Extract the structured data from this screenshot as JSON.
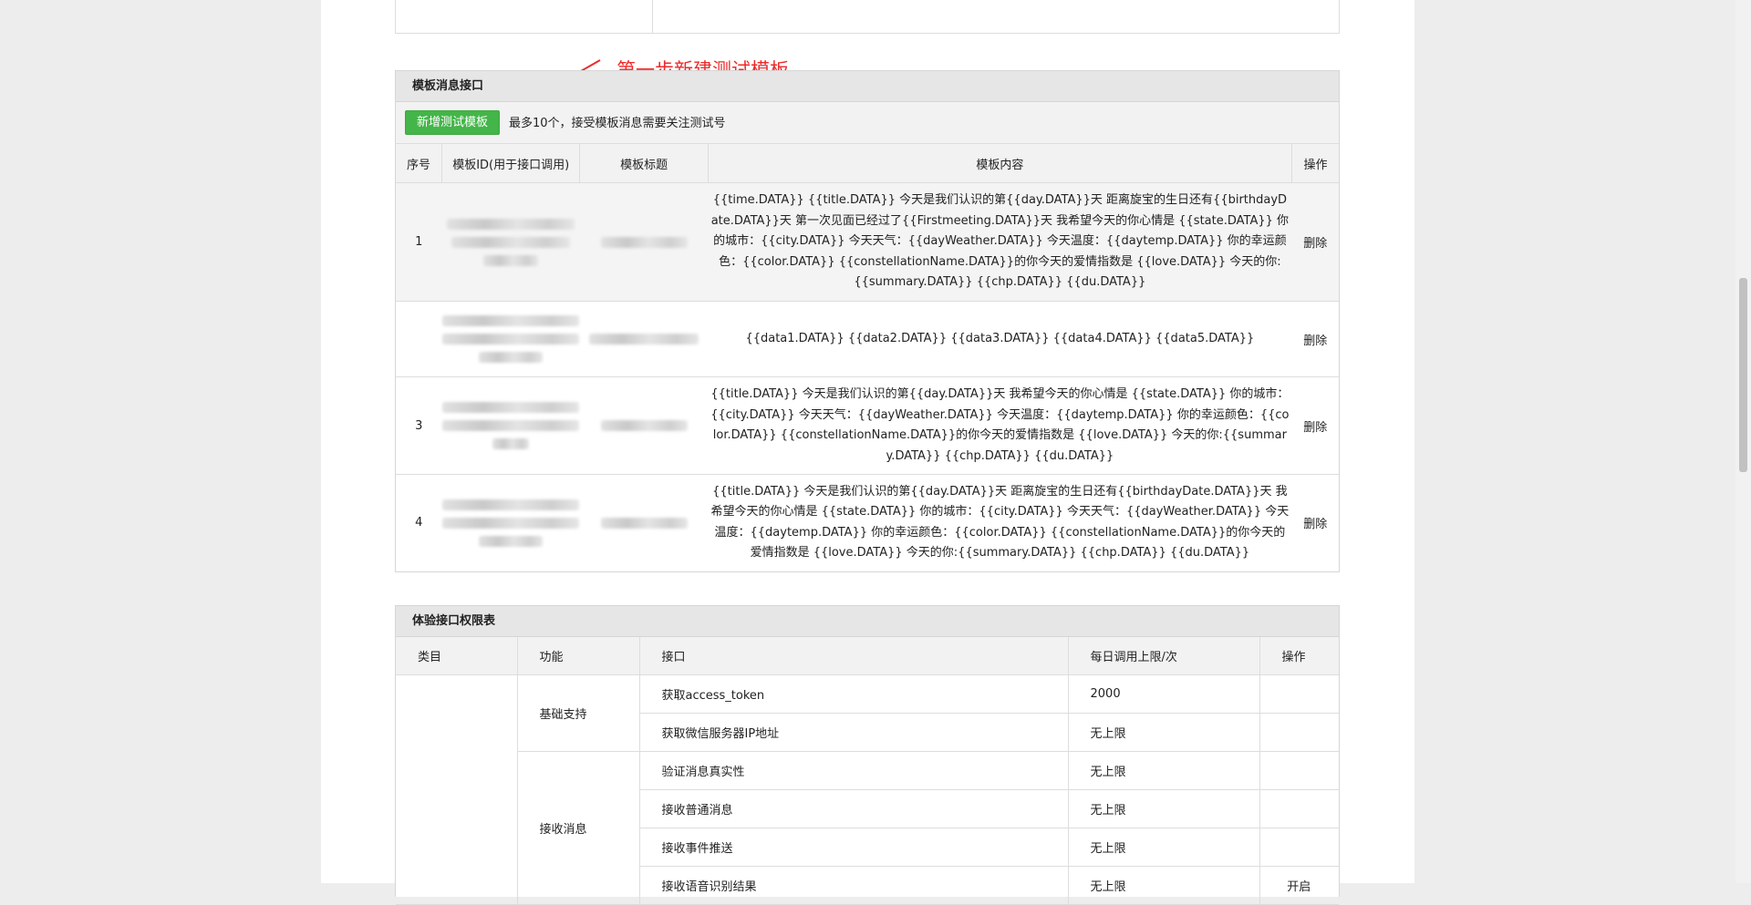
{
  "annotation": {
    "text": "第一步新建测试模板",
    "color": "#ee2a2a"
  },
  "template_panel": {
    "title": "模板消息接口",
    "add_button": "新增测试模板",
    "hint": "最多10个，接受模板消息需要关注测试号",
    "headers": [
      "序号",
      "模板ID(用于接口调用)",
      "模板标题",
      "模板内容",
      "操作"
    ],
    "rows": [
      {
        "index": "1",
        "content": "{{time.DATA}} {{title.DATA}} 今天是我们认识的第{{day.DATA}}天 距离旋宝的生日还有{{birthdayDate.DATA}}天 第一次见面已经过了{{Firstmeeting.DATA}}天 我希望今天的你心情是 {{state.DATA}} 你的城市：{{city.DATA}} 今天天气：{{dayWeather.DATA}} 今天温度：{{daytemp.DATA}} 你的幸运颜色：{{color.DATA}} {{constellationName.DATA}}的你今天的爱情指数是 {{love.DATA}} 今天的你:{{summary.DATA}} {{chp.DATA}} {{du.DATA}}",
        "action": "删除"
      },
      {
        "index": "",
        "content": "{{data1.DATA}} {{data2.DATA}} {{data3.DATA}} {{data4.DATA}} {{data5.DATA}}",
        "action": "删除"
      },
      {
        "index": "3",
        "content": "{{title.DATA}} 今天是我们认识的第{{day.DATA}}天 我希望今天的你心情是 {{state.DATA}} 你的城市：{{city.DATA}} 今天天气：{{dayWeather.DATA}} 今天温度：{{daytemp.DATA}} 你的幸运颜色：{{color.DATA}} {{constellationName.DATA}}的你今天的爱情指数是 {{love.DATA}} 今天的你:{{summary.DATA}} {{chp.DATA}} {{du.DATA}}",
        "action": "删除"
      },
      {
        "index": "4",
        "content": "{{title.DATA}} 今天是我们认识的第{{day.DATA}}天 距离旋宝的生日还有{{birthdayDate.DATA}}天 我希望今天的你心情是 {{state.DATA}} 你的城市：{{city.DATA}} 今天天气：{{dayWeather.DATA}} 今天温度：{{daytemp.DATA}} 你的幸运颜色：{{color.DATA}} {{constellationName.DATA}}的你今天的爱情指数是 {{love.DATA}} 今天的你:{{summary.DATA}} {{chp.DATA}} {{du.DATA}}",
        "action": "删除"
      }
    ]
  },
  "perm_panel": {
    "title": "体验接口权限表",
    "headers": [
      "类目",
      "功能",
      "接口",
      "每日调用上限/次",
      "操作"
    ],
    "groups": [
      {
        "function": "基础支持",
        "rows": [
          {
            "api": "获取access_token",
            "limit": "2000",
            "action": ""
          },
          {
            "api": "获取微信服务器IP地址",
            "limit": "无上限",
            "action": ""
          }
        ]
      },
      {
        "function": "接收消息",
        "rows": [
          {
            "api": "验证消息真实性",
            "limit": "无上限",
            "action": ""
          },
          {
            "api": "接收普通消息",
            "limit": "无上限",
            "action": ""
          },
          {
            "api": "接收事件推送",
            "limit": "无上限",
            "action": ""
          },
          {
            "api": "接收语音识别结果",
            "limit": "无上限",
            "action": "开启"
          }
        ]
      }
    ]
  },
  "colors": {
    "green_button": "#44b549",
    "link": "#459ae9",
    "annotation": "#ee2a2a"
  }
}
